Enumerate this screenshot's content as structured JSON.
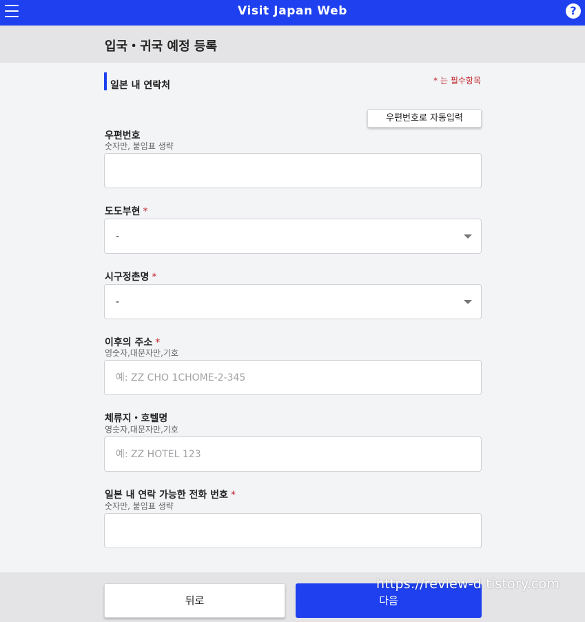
{
  "appbar": {
    "title": "Visit Japan Web",
    "help_glyph": "?",
    "menu_icon": "hamburger-menu-icon",
    "help_icon": "question-circle-icon",
    "accent_color": "#1e40ee"
  },
  "page": {
    "title": "입국・귀국 예정 등록"
  },
  "section": {
    "title": "일본 내 연락처",
    "required_note": "* 는 필수항목",
    "auto_fill_button": "우편번호로 자동입력"
  },
  "fields": {
    "postal": {
      "label": "우편번호",
      "hint": "숫자만, 붙임표 생략",
      "value": "",
      "placeholder": ""
    },
    "prefecture": {
      "label": "도도부현",
      "required_mark": "*",
      "selected": "-"
    },
    "city": {
      "label": "시구정촌명",
      "required_mark": "*",
      "selected": "-"
    },
    "address": {
      "label": "이후의 주소",
      "required_mark": "*",
      "hint": "영숫자,대문자만,기호",
      "placeholder": "예: ZZ CHO 1CHOME-2-345"
    },
    "hotel": {
      "label": "체류지・호텔명",
      "hint": "영숫자,대문자만,기호",
      "placeholder": "예: ZZ HOTEL 123"
    },
    "phone": {
      "label": "일본 내 연락 가능한 전화 번호",
      "required_mark": "*",
      "hint": "숫자만, 붙임표 생략",
      "value": "",
      "placeholder": ""
    }
  },
  "footer": {
    "back_label": "뒤로",
    "next_label": "다음"
  },
  "watermark": "https://review-d.tistory.com",
  "colors": {
    "required": "#c0242b",
    "header_band": "#e4e4e6"
  }
}
